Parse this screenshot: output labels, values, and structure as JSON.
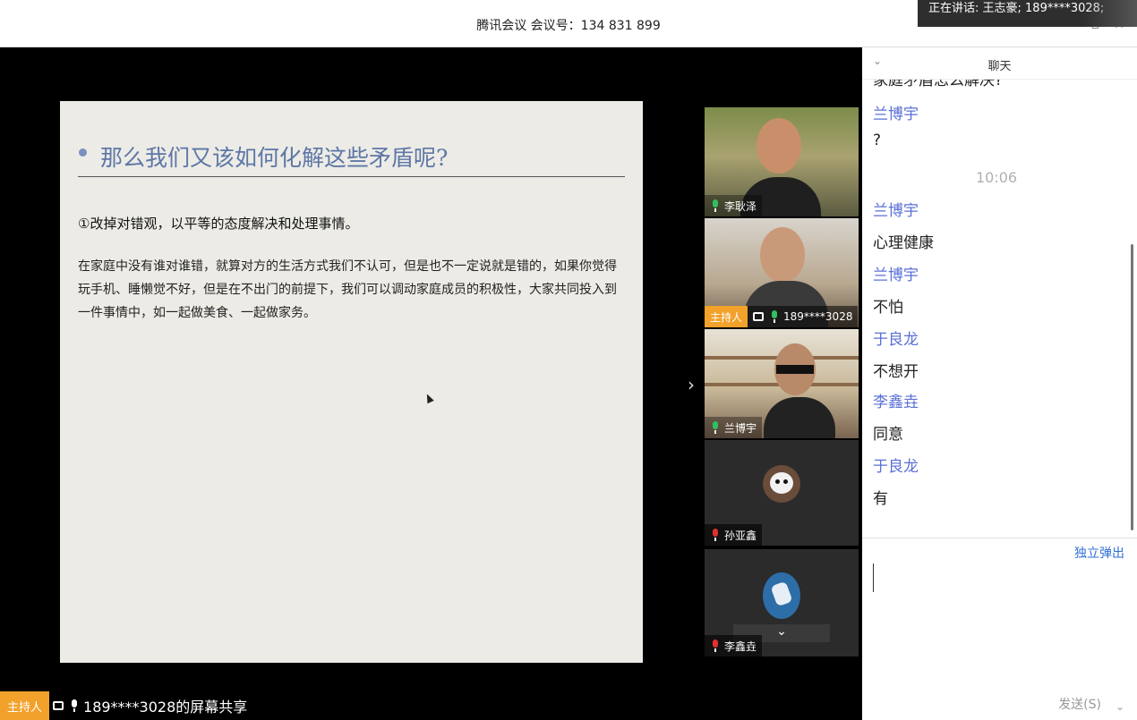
{
  "titlebar": {
    "title": "腾讯会议 会议号：134 831 899",
    "speaking": "正在讲话: 王志豪; 189****3028;"
  },
  "slide": {
    "heading": "那么我们又该如何化解这些矛盾呢?",
    "subheading": "①改掉对错观，以平等的态度解决和处理事情。",
    "paragraph": "在家庭中没有谁对谁错，就算对方的生活方式我们不认可，但是也不一定说就是错的，如果你觉得玩手机、睡懒觉不好，但是在不出门的前提下，我们可以调动家庭成员的积极性，大家共同投入到一件事情中，如一起做美食、一起做家务。"
  },
  "participants": [
    {
      "name": "李耿泽",
      "mic": "on"
    },
    {
      "name": "189****3028",
      "mic": "on",
      "host_label": "主持人"
    },
    {
      "name": "兰博宇",
      "mic": "on"
    },
    {
      "name": "孙亚鑫",
      "mic": "off"
    },
    {
      "name": "李鑫垚",
      "mic": "off"
    }
  ],
  "bottom_bar": {
    "host_label": "主持人",
    "share_text": "189****3028的屏幕共享"
  },
  "chat": {
    "title": "聊天",
    "cut_text": "家庭矛盾怎么解决?",
    "messages": [
      {
        "sender": "兰博宇",
        "text": "?"
      },
      {
        "time": "10:06"
      },
      {
        "sender": "兰博宇",
        "text": "心理健康"
      },
      {
        "sender": "兰博宇",
        "text": "不怕"
      },
      {
        "sender": "于良龙",
        "text": "不想开"
      },
      {
        "sender": "李鑫垚",
        "text": "同意"
      },
      {
        "sender": "于良龙",
        "text": "有"
      }
    ],
    "popout_label": "独立弹出",
    "send_label": "发送(S)"
  },
  "colors": {
    "host_tag": "#f2a12a",
    "sender_name": "#5a6fd6",
    "link": "#2f6fd6",
    "slide_heading": "#5d77a6"
  }
}
